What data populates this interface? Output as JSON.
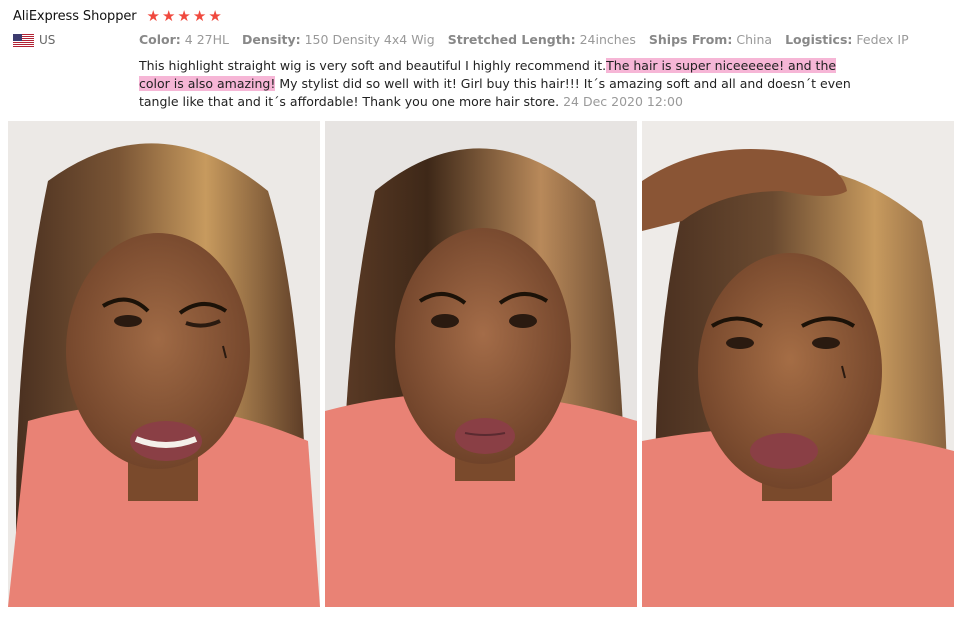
{
  "review": {
    "reviewer": "AliExpress Shopper",
    "rating": 5,
    "country": "US",
    "attributes": [
      {
        "key": "Color:",
        "value": "4 27HL"
      },
      {
        "key": "Density:",
        "value": "150 Density 4x4 Wig"
      },
      {
        "key": "Stretched Length:",
        "value": "24inches"
      },
      {
        "key": "Ships From:",
        "value": "China"
      },
      {
        "key": "Logistics:",
        "value": "Fedex IP"
      }
    ],
    "text_before": "This highlight straight wig is very soft and beautiful I highly recommend it.",
    "text_highlight": "The hair is super niceeeeee! and the color is also amazing!",
    "text_after": " My stylist did so well with it! Girl buy this hair!!! It´s amazing soft and all and doesn´t even tangle like that and it´s affordable! Thank you one more hair store.",
    "date": "24 Dec 2020 12:00"
  },
  "photos": [
    {
      "name": "review-photo-1"
    },
    {
      "name": "review-photo-2"
    },
    {
      "name": "review-photo-3"
    }
  ],
  "colors": {
    "star": "#f0493e",
    "highlight": "#f6b6d6",
    "shirt": "#e98275",
    "skin": "#8a5535",
    "hair_dark": "#4a3020",
    "hair_light": "#c79a5e",
    "wall": "#ece9e6"
  }
}
